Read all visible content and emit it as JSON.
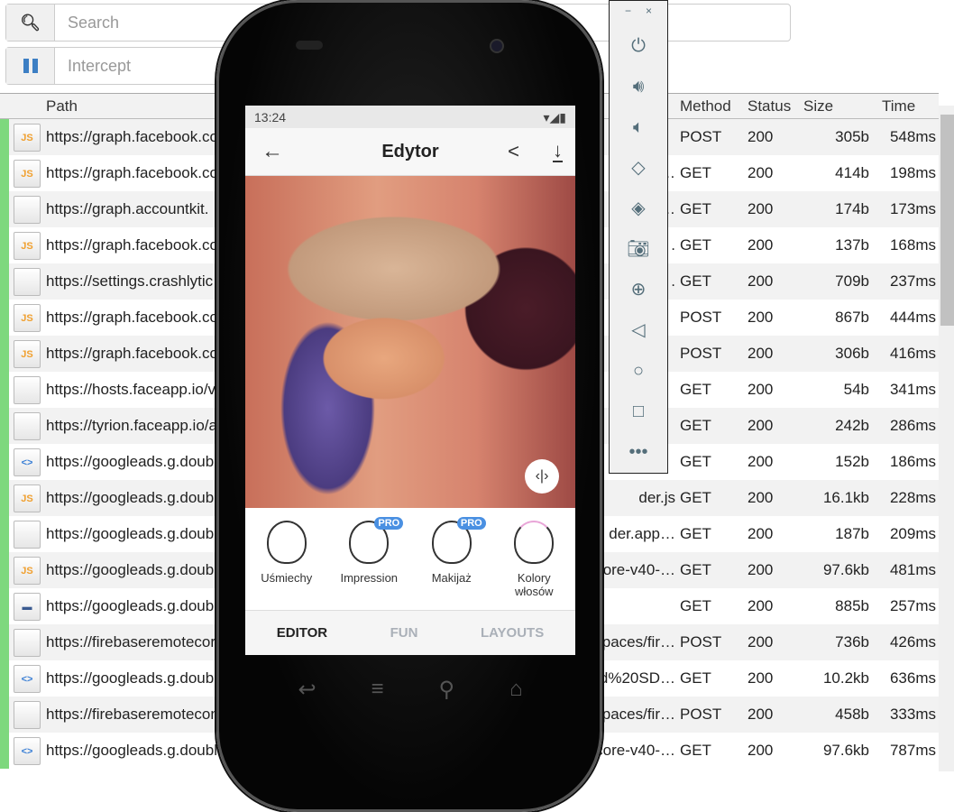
{
  "search": {
    "placeholder": "Search",
    "icon": "search-icon"
  },
  "intercept": {
    "placeholder": "Intercept",
    "icon": "pause-icon",
    "color": "#3d7fc4"
  },
  "columns": {
    "path": "Path",
    "method": "Method",
    "status": "Status",
    "size": "Size",
    "time": "Time"
  },
  "rows": [
    {
      "type": "js",
      "path": "https://graph.facebook.co",
      "tail": "",
      "method": "POST",
      "status": "200",
      "size": "305b",
      "time": "548ms"
    },
    {
      "type": "js",
      "path": "https://graph.facebook.co",
      "tail": "…",
      "method": "GET",
      "status": "200",
      "size": "414b",
      "time": "198ms"
    },
    {
      "type": "blank",
      "path": "https://graph.accountkit.",
      "tail": "…",
      "method": "GET",
      "status": "200",
      "size": "174b",
      "time": "173ms"
    },
    {
      "type": "js",
      "path": "https://graph.facebook.co",
      "tail": ".",
      "method": "GET",
      "status": "200",
      "size": "137b",
      "time": "168ms"
    },
    {
      "type": "blank",
      "path": "https://settings.crashlytic",
      "tail": ".",
      "method": "GET",
      "status": "200",
      "size": "709b",
      "time": "237ms"
    },
    {
      "type": "js",
      "path": "https://graph.facebook.co",
      "tail": "",
      "method": "POST",
      "status": "200",
      "size": "867b",
      "time": "444ms"
    },
    {
      "type": "js",
      "path": "https://graph.facebook.co",
      "tail": "",
      "method": "POST",
      "status": "200",
      "size": "306b",
      "time": "416ms"
    },
    {
      "type": "blank",
      "path": "https://hosts.faceapp.io/v",
      "tail": "",
      "method": "GET",
      "status": "200",
      "size": "54b",
      "time": "341ms"
    },
    {
      "type": "blank",
      "path": "https://tyrion.faceapp.io/a",
      "tail": "",
      "method": "GET",
      "status": "200",
      "size": "242b",
      "time": "286ms"
    },
    {
      "type": "html",
      "path": "https://googleads.g.doub",
      "tail": "",
      "method": "GET",
      "status": "200",
      "size": "152b",
      "time": "186ms"
    },
    {
      "type": "js",
      "path": "https://googleads.g.doub",
      "tail": "der.js",
      "method": "GET",
      "status": "200",
      "size": "16.1kb",
      "time": "228ms"
    },
    {
      "type": "blank",
      "path": "https://googleads.g.doub",
      "tail": "der.app…",
      "method": "GET",
      "status": "200",
      "size": "187b",
      "time": "209ms"
    },
    {
      "type": "js",
      "path": "https://googleads.g.doub",
      "tail": "core-v40-…",
      "method": "GET",
      "status": "200",
      "size": "97.6kb",
      "time": "481ms"
    },
    {
      "type": "img",
      "path": "https://googleads.g.doub",
      "tail": "",
      "method": "GET",
      "status": "200",
      "size": "885b",
      "time": "257ms"
    },
    {
      "type": "blank",
      "path": "https://firebaseremotecor",
      "tail": "spaces/fir…",
      "method": "POST",
      "status": "200",
      "size": "736b",
      "time": "426ms"
    },
    {
      "type": "html",
      "path": "https://googleads.g.doub",
      "tail": "d%20SD…",
      "method": "GET",
      "status": "200",
      "size": "10.2kb",
      "time": "636ms"
    },
    {
      "type": "blank",
      "path": "https://firebaseremoteconfi",
      "tail": "spaces/fir…",
      "method": "POST",
      "status": "200",
      "size": "458b",
      "time": "333ms"
    },
    {
      "type": "html",
      "path": "https://googleads.g.doubleclick.net",
      "tail": "ction/sdk-core-v40-…",
      "method": "GET",
      "status": "200",
      "size": "97.6kb",
      "time": "787ms"
    }
  ],
  "phone": {
    "time": "13:24",
    "title": "Edytor",
    "features": [
      {
        "label": "Uśmiechy",
        "pro": ""
      },
      {
        "label": "Impression",
        "pro": "PRO"
      },
      {
        "label": "Makijaż",
        "pro": "PRO"
      },
      {
        "label": "Kolory włosów",
        "pro": ""
      }
    ],
    "tabs": [
      "EDITOR",
      "FUN",
      "LAYOUTS"
    ]
  },
  "emulator": {
    "minimize": "−",
    "close": "×"
  }
}
